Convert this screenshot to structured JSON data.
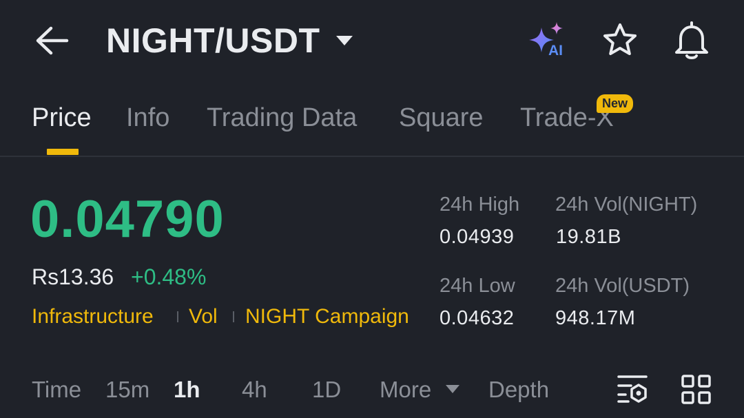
{
  "header": {
    "pair": "NIGHT/USDT",
    "ai_label": "AI",
    "icons": {
      "back": "arrow-left-icon",
      "pair_dropdown": "caret-down-icon",
      "ai": "sparkle-ai-icon",
      "favorite": "star-icon",
      "alerts": "bell-icon"
    }
  },
  "tabs": {
    "items": [
      {
        "label": "Price",
        "active": true
      },
      {
        "label": "Info"
      },
      {
        "label": "Trading Data"
      },
      {
        "label": "Square"
      },
      {
        "label": "Trade-X"
      }
    ],
    "new_badge": "New"
  },
  "price": {
    "last": "0.04790",
    "fiat": "Rs13.36",
    "change": "+0.48%"
  },
  "tags": [
    "Infrastructure",
    "Vol",
    "NIGHT Campaign"
  ],
  "stats": {
    "high_label": "24h High",
    "high_value": "0.04939",
    "vol_base_label": "24h Vol(NIGHT)",
    "vol_base_value": "19.81B",
    "low_label": "24h Low",
    "low_value": "0.04632",
    "vol_quote_label": "24h Vol(USDT)",
    "vol_quote_value": "948.17M"
  },
  "intervals": {
    "time": "Time",
    "m15": "15m",
    "h1": "1h",
    "h4": "4h",
    "d1": "1D",
    "more": "More",
    "depth": "Depth",
    "active": "1h",
    "icons": {
      "more": "caret-down-icon",
      "indicators": "indicator-settings-icon",
      "layout": "grid-layout-icon"
    }
  },
  "colors": {
    "background": "#1f2229",
    "up": "#2ebd85",
    "accent": "#f0b90b",
    "muted": "#8b8f97",
    "text": "#eaecef"
  }
}
